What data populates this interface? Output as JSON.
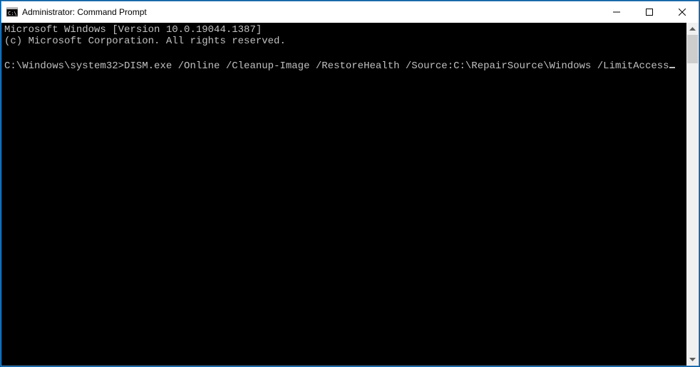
{
  "window": {
    "title": "Administrator: Command Prompt"
  },
  "terminal": {
    "version_line": "Microsoft Windows [Version 10.0.19044.1387]",
    "copyright_line": "(c) Microsoft Corporation. All rights reserved.",
    "prompt_path": "C:\\Windows\\system32>",
    "command": "DISM.exe /Online /Cleanup-Image /RestoreHealth /Source:C:\\RepairSource\\Windows /LimitAccess"
  },
  "colors": {
    "window_border": "#4a8bc2",
    "terminal_bg": "#000000",
    "terminal_fg": "#c0c0c0",
    "titlebar_bg": "#ffffff"
  }
}
